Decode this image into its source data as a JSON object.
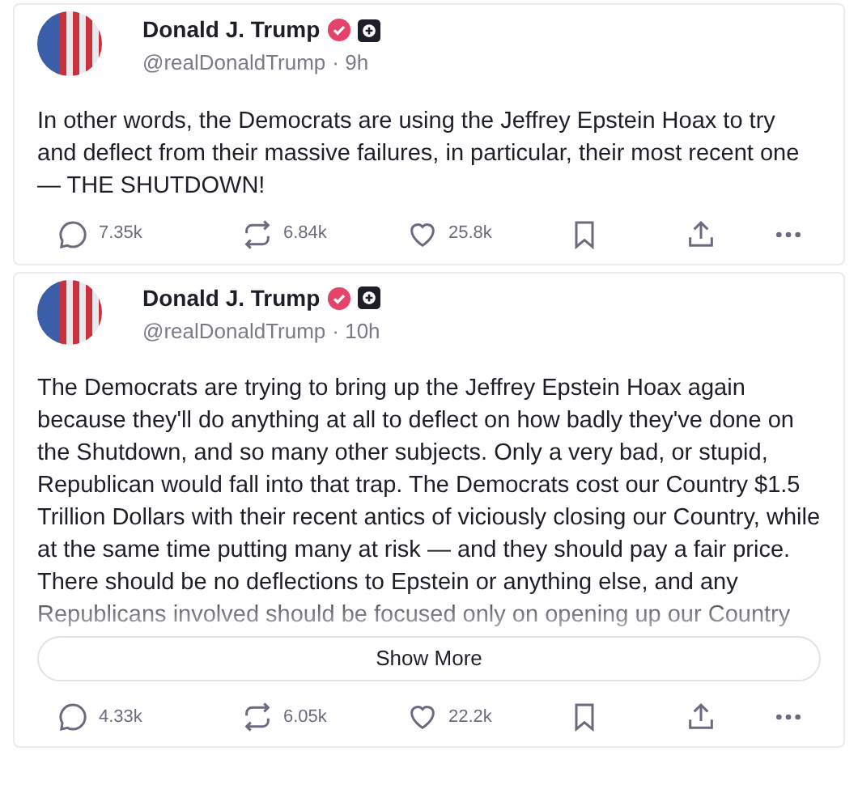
{
  "posts": [
    {
      "name": "Donald J. Trump",
      "handle": "@realDonaldTrump",
      "time": "· 9h",
      "verified": true,
      "text": "In other words, the Democrats are using the Jeffrey Epstein Hoax to try and deflect from their massive failures, in particular, their most recent one — THE SHUTDOWN!",
      "truncated": false,
      "stats": {
        "replies": "7.35k",
        "reposts": "6.84k",
        "likes": "25.8k"
      }
    },
    {
      "name": "Donald J. Trump",
      "handle": "@realDonaldTrump",
      "time": "· 10h",
      "verified": true,
      "text": "The Democrats are trying to bring up the Jeffrey Epstein Hoax again because they'll do anything at all to deflect on how badly they've done on the Shutdown, and so many other subjects. Only a very bad, or stupid, Republican would fall into that trap. The Democrats cost our Country $1.5 Trillion Dollars with their recent antics of viciously closing our Country, while at the same time putting many at risk — and they should pay a fair price. There should be no deflections to Epstein or anything else, and any Republicans involved should be focused only on opening up our Country",
      "truncated": true,
      "show_more": "Show More",
      "stats": {
        "replies": "4.33k",
        "reposts": "6.05k",
        "likes": "22.2k"
      }
    }
  ]
}
